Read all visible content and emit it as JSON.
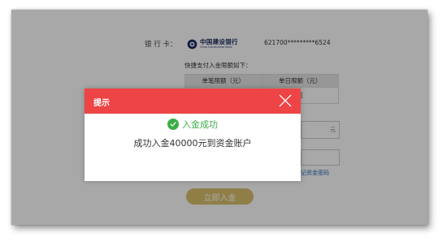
{
  "bank": {
    "label": "银  行  卡：",
    "logo_cn": "中国建设银行",
    "logo_en": "China Construction Bank",
    "card_number": "621700*********6524"
  },
  "limits": {
    "title": "快捷支付入金限额如下：",
    "headers": [
      "单笔限额（元）",
      "单日限额（元）"
    ],
    "row": [
      "",
      "万"
    ]
  },
  "form": {
    "amount_unit": "元",
    "forgot_link": "记资金密码",
    "submit_label": "立即入金"
  },
  "dialog": {
    "title": "提示",
    "status": "入金成功",
    "message": "成功入金40000元到资金账户"
  },
  "colors": {
    "dialog_header": "#ee4445",
    "success": "#3dae47",
    "submit": "#d9c16c",
    "link": "#2b6cc4"
  }
}
